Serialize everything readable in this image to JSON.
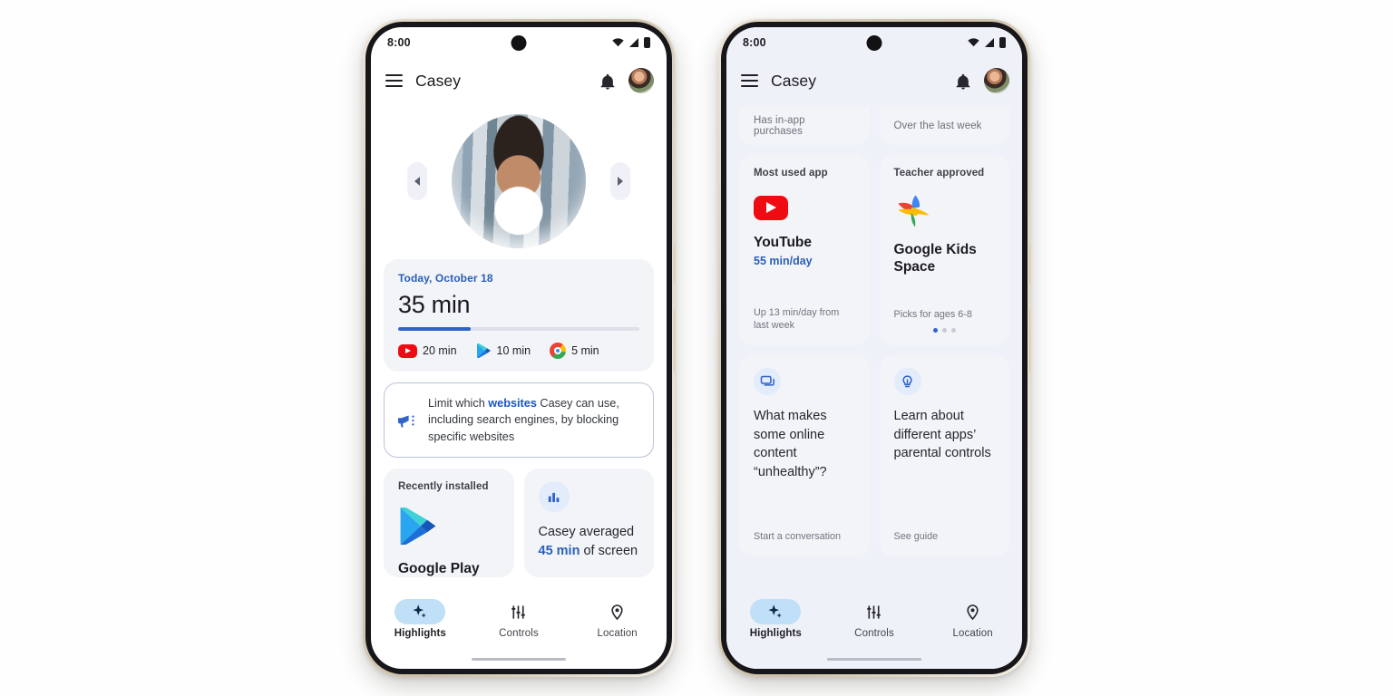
{
  "phones": [
    {
      "id": "phone-left",
      "status": {
        "time": "8:00",
        "icons": [
          "wifi-icon",
          "signal-icon",
          "battery-icon"
        ]
      },
      "appbar": {
        "menu_icon": "hamburger-menu-icon",
        "title": "Casey",
        "bell_icon": "notification-bell-icon",
        "avatar": "parent-avatar"
      },
      "carousel": {
        "prev_icon": "chevron-left-icon",
        "next_icon": "chevron-right-icon",
        "photo": "child-profile-photo"
      },
      "screen_time": {
        "date": "Today, October 18",
        "total": "35 min",
        "progress_percent": 30,
        "apps": [
          {
            "icon": "youtube-icon",
            "time": "20 min"
          },
          {
            "icon": "google-play-icon",
            "time": "10 min"
          },
          {
            "icon": "chrome-icon",
            "time": "5 min"
          }
        ]
      },
      "banner": {
        "icon": "megaphone-icon",
        "text_before": "Limit which ",
        "highlight": "websites",
        "text_after": " Casey can use, including search engines, by blocking specific websites"
      },
      "cards": [
        {
          "kicker": "Recently installed",
          "icon": "google-play-icon",
          "title": "Google Play"
        },
        {
          "icon": "bar-chart-icon",
          "text_before": "Casey averaged ",
          "highlight": "45 min",
          "text_after": " of screen"
        }
      ]
    },
    {
      "id": "phone-right",
      "status": {
        "time": "8:00",
        "icons": [
          "wifi-icon",
          "signal-icon",
          "battery-icon"
        ]
      },
      "appbar": {
        "menu_icon": "hamburger-menu-icon",
        "title": "Casey",
        "bell_icon": "notification-bell-icon",
        "avatar": "parent-avatar"
      },
      "clipped_cards": [
        {
          "foot": "Has in-app purchases"
        },
        {
          "foot": "Over the last week"
        }
      ],
      "cards": [
        {
          "kicker": "Most used app",
          "icon": "youtube-icon",
          "title": "YouTube",
          "sub": "55 min/day",
          "foot": "Up 13 min/day from last week"
        },
        {
          "kicker": "Teacher approved",
          "icon": "google-kids-space-icon",
          "title": "Google Kids Space",
          "foot": "Picks for ages 6-8",
          "dots": {
            "count": 3,
            "active": 0
          }
        },
        {
          "icon": "chat-bubble-icon",
          "title": "What makes some online content “unhealthy”?",
          "foot": "Start a conversation"
        },
        {
          "icon": "lightbulb-icon",
          "title": "Learn about different apps’ parental controls",
          "foot": "See guide"
        }
      ]
    }
  ],
  "bottom_nav": {
    "items": [
      {
        "icon": "sparkle-icon",
        "label": "Highlights",
        "active": true
      },
      {
        "icon": "sliders-icon",
        "label": "Controls",
        "active": false
      },
      {
        "icon": "location-pin-icon",
        "label": "Location",
        "active": false
      }
    ]
  },
  "colors": {
    "accent_blue": "#2f63c7",
    "link_blue": "#2a5fb8",
    "nav_pill": "#bfe0f6",
    "card_bg": "#f3f4f8",
    "tinted_bg": "#eef1f8",
    "youtube_red": "#ef0b12"
  }
}
